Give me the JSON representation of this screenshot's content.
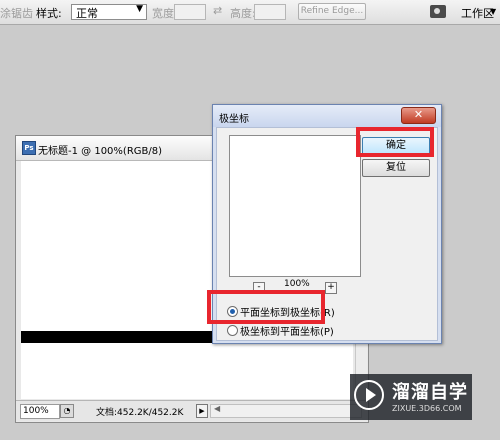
{
  "options_bar": {
    "feather_label": "涂锯齿",
    "style_label": "样式:",
    "style_value": "正常",
    "width_label": "宽度:",
    "swap_icon": "⇄",
    "height_label": "高度:",
    "refine_edge_label": "Refine Edge...",
    "workspace_label": "工作区",
    "workspace_arrow": "▼"
  },
  "document": {
    "title": "无标题-1 @ 100%(RGB/8)",
    "ps_icon": "Ps",
    "zoom": "100%",
    "doc_info": "文档:452.2K/452.2K",
    "menu_arrow": "▶",
    "scroll_left": "◀"
  },
  "dialog": {
    "title": "极坐标",
    "close_label": "✕",
    "ok_label": "确定",
    "reset_label": "复位",
    "zoom_minus": "-",
    "zoom_value": "100%",
    "zoom_plus": "+",
    "option_rect_to_polar": "平面坐标到极坐标(R)",
    "option_polar_to_rect": "极坐标到平面坐标(P)",
    "selected_option": "rect_to_polar"
  },
  "watermark": {
    "name": "溜溜自学",
    "url": "ZIXUE.3D66.COM"
  },
  "colors": {
    "highlight": "#e8262e",
    "workspace_bg": "#cbcbcb"
  }
}
